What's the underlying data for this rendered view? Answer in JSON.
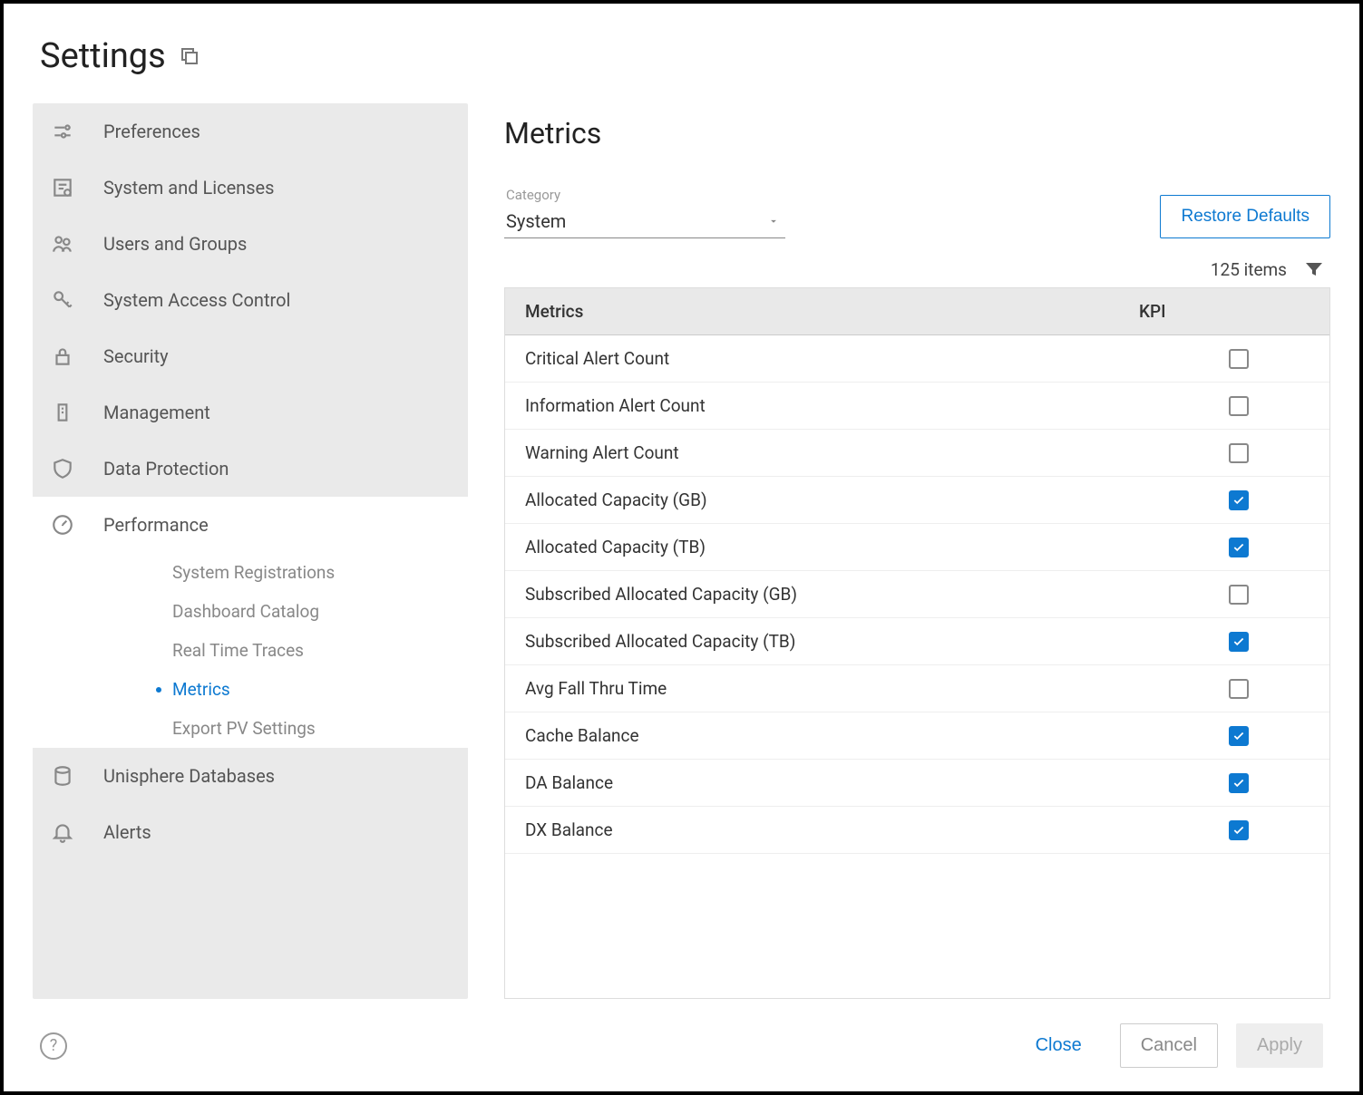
{
  "header": {
    "title": "Settings"
  },
  "sidebar": {
    "items": [
      {
        "label": "Preferences"
      },
      {
        "label": "System and Licenses"
      },
      {
        "label": "Users and Groups"
      },
      {
        "label": "System Access Control"
      },
      {
        "label": "Security"
      },
      {
        "label": "Management"
      },
      {
        "label": "Data Protection"
      },
      {
        "label": "Performance"
      },
      {
        "label": "Unisphere Databases"
      },
      {
        "label": "Alerts"
      }
    ],
    "performance_sub": [
      {
        "label": "System Registrations"
      },
      {
        "label": "Dashboard Catalog"
      },
      {
        "label": "Real Time Traces"
      },
      {
        "label": "Metrics"
      },
      {
        "label": "Export PV Settings"
      }
    ]
  },
  "main": {
    "title": "Metrics",
    "category_label": "Category",
    "category_value": "System",
    "restore_label": "Restore Defaults",
    "items_count": "125 items",
    "table": {
      "headers": {
        "metric": "Metrics",
        "kpi": "KPI"
      },
      "rows": [
        {
          "metric": "Critical Alert Count",
          "kpi": false
        },
        {
          "metric": "Information Alert Count",
          "kpi": false
        },
        {
          "metric": "Warning Alert Count",
          "kpi": false
        },
        {
          "metric": "Allocated Capacity (GB)",
          "kpi": true
        },
        {
          "metric": "Allocated Capacity (TB)",
          "kpi": true
        },
        {
          "metric": "Subscribed Allocated Capacity (GB)",
          "kpi": false
        },
        {
          "metric": "Subscribed Allocated Capacity (TB)",
          "kpi": true
        },
        {
          "metric": "Avg Fall Thru Time",
          "kpi": false
        },
        {
          "metric": "Cache Balance",
          "kpi": true
        },
        {
          "metric": "DA Balance",
          "kpi": true
        },
        {
          "metric": "DX Balance",
          "kpi": true
        }
      ]
    }
  },
  "footer": {
    "close": "Close",
    "cancel": "Cancel",
    "apply": "Apply"
  }
}
